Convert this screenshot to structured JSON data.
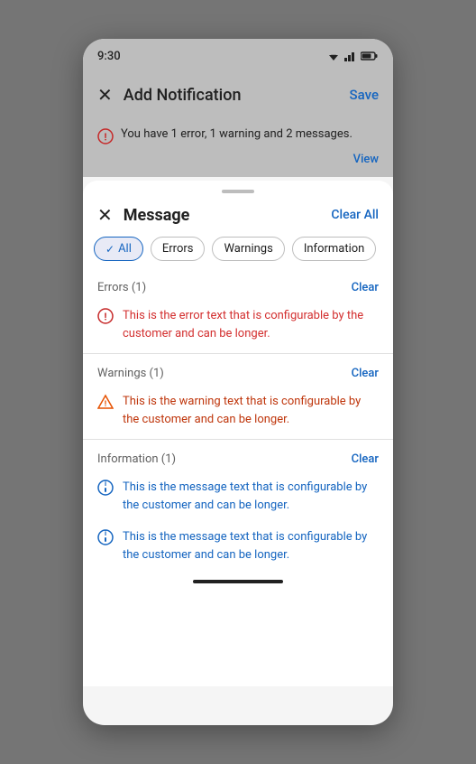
{
  "statusBar": {
    "time": "9:30",
    "icons": "▼◀▌"
  },
  "topAppBar": {
    "closeIcon": "✕",
    "title": "Add Notification",
    "saveLabel": "Save"
  },
  "errorBanner": {
    "icon": "ⓘ",
    "message": "You have 1 error, 1 warning and 2 messages.",
    "viewLabel": "View"
  },
  "sheet": {
    "handleAlt": "drag handle",
    "closeIcon": "✕",
    "title": "Message",
    "clearAllLabel": "Clear All"
  },
  "chips": [
    {
      "id": "all",
      "label": "All",
      "active": true
    },
    {
      "id": "errors",
      "label": "Errors",
      "active": false
    },
    {
      "id": "warnings",
      "label": "Warnings",
      "active": false
    },
    {
      "id": "information",
      "label": "Information",
      "active": false
    }
  ],
  "sections": [
    {
      "id": "errors",
      "label": "Errors (1)",
      "clearLabel": "Clear",
      "messages": [
        {
          "type": "error",
          "text": "This is the error text that is configurable by the customer and can be longer."
        }
      ]
    },
    {
      "id": "warnings",
      "label": "Warnings (1)",
      "clearLabel": "Clear",
      "messages": [
        {
          "type": "warning",
          "text": "This is the warning text that is configurable by the customer and can be longer."
        }
      ]
    },
    {
      "id": "information",
      "label": "Information (1)",
      "clearLabel": "Clear",
      "messages": [
        {
          "type": "info",
          "text": "This is the message text that is configurable by the customer and can be longer."
        },
        {
          "type": "info",
          "text": "This is the message text that is configurable by the customer and can be longer."
        }
      ]
    }
  ]
}
